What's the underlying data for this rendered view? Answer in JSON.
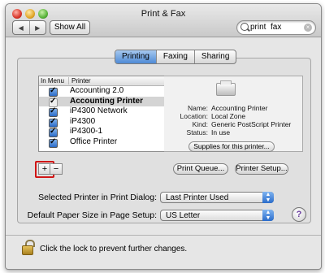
{
  "window": {
    "title": "Print & Fax"
  },
  "toolbar": {
    "back_glyph": "◀",
    "forward_glyph": "▶",
    "show_all_label": "Show All",
    "search_value": "print  fax",
    "clear_glyph": "×"
  },
  "tabs": [
    {
      "label": "Printing",
      "active": true
    },
    {
      "label": "Faxing",
      "active": false
    },
    {
      "label": "Sharing",
      "active": false
    }
  ],
  "printer_list": {
    "headers": {
      "in_menu": "In Menu",
      "printer": "Printer"
    },
    "rows": [
      {
        "name": "Accounting 2.0",
        "checked": true,
        "selected": false
      },
      {
        "name": "Accounting Printer",
        "checked": true,
        "selected": true
      },
      {
        "name": "iP4300 Network",
        "checked": true,
        "selected": false
      },
      {
        "name": "iP4300",
        "checked": true,
        "selected": false
      },
      {
        "name": "iP4300-1",
        "checked": true,
        "selected": false
      },
      {
        "name": "Office Printer",
        "checked": true,
        "selected": false
      }
    ]
  },
  "details": {
    "name_label": "Name:",
    "name_value": "Accounting Printer",
    "location_label": "Location:",
    "location_value": "Local Zone",
    "kind_label": "Kind:",
    "kind_value": "Generic PostScript Printer",
    "status_label": "Status:",
    "status_value": "In use",
    "supplies_label": "Supplies for this printer..."
  },
  "list_controls": {
    "add": "+",
    "remove": "−"
  },
  "buttons": {
    "print_queue": "Print Queue...",
    "printer_setup": "Printer Setup..."
  },
  "preferences": {
    "selected_printer_label": "Selected Printer in Print Dialog:",
    "selected_printer_value": "Last Printer Used",
    "paper_size_label": "Default Paper Size in Page Setup:",
    "paper_size_value": "US Letter",
    "help": "?"
  },
  "footer": {
    "lock_text": "Click the lock to prevent further changes."
  },
  "colors": {
    "accent": "#4f8bd6",
    "highlight_ring": "#d01616"
  }
}
